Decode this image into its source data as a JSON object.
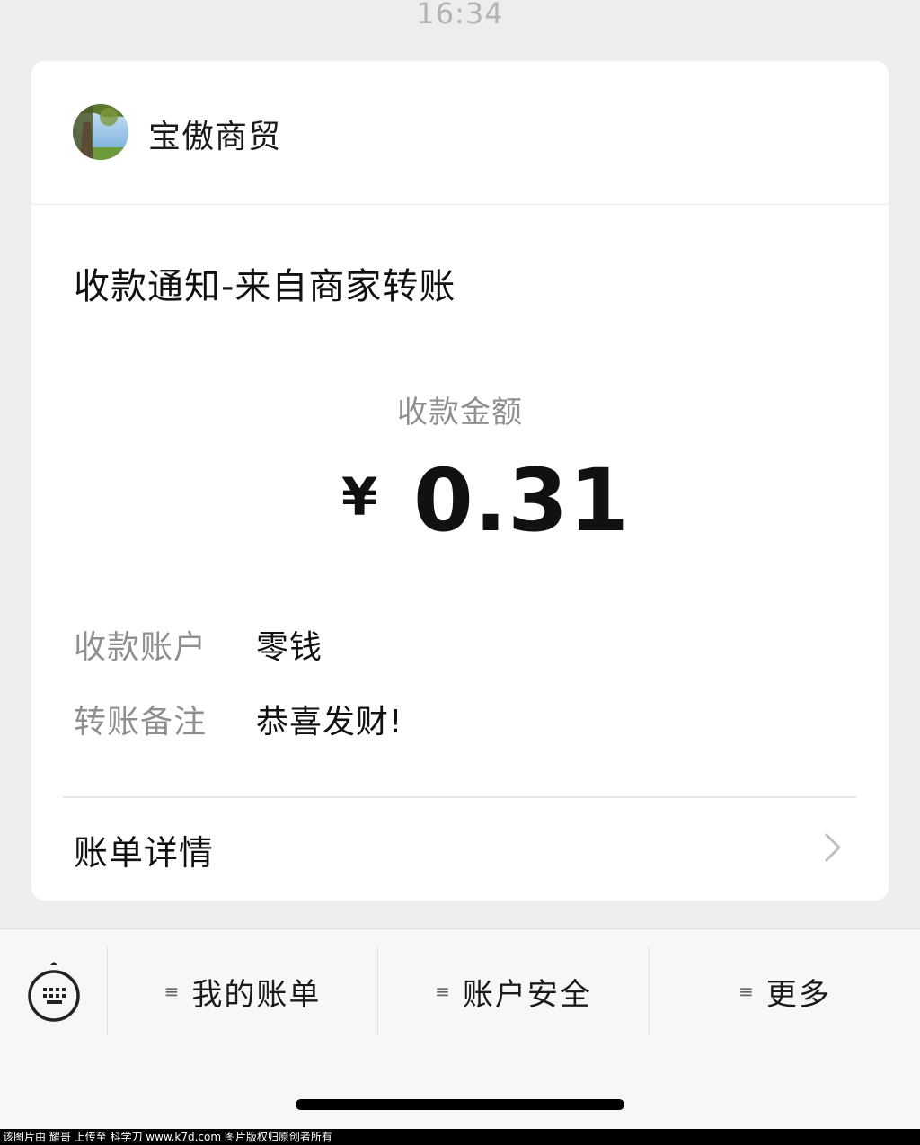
{
  "status_bar": {
    "time": "16:34"
  },
  "header": {
    "merchant_name": "宝傲商贸",
    "avatar_icon": "tree-landscape-avatar"
  },
  "notice": {
    "title": "收款通知-来自商家转账"
  },
  "amount": {
    "label": "收款金额",
    "currency": "¥",
    "value": "0.31"
  },
  "details": [
    {
      "label": "收款账户",
      "value": "零钱"
    },
    {
      "label": "转账备注",
      "value": "恭喜发财!"
    }
  ],
  "bill_detail": {
    "label": "账单详情",
    "icon": "chevron-right-icon"
  },
  "bottom_menu": {
    "keyboard_icon": "keyboard-icon",
    "menu_glyph": "≡",
    "items": [
      {
        "label": "我的账单"
      },
      {
        "label": "账户安全"
      },
      {
        "label": "更多"
      }
    ]
  },
  "watermark": "该图片由 耀哥 上传至 科学刀 www.k7d.com 图片版权归原创者所有",
  "colors": {
    "background": "#ededed",
    "card": "#ffffff",
    "secondary_text": "#8f8f8f",
    "primary_text": "#111111",
    "bottom_bar": "#f7f7f7"
  }
}
